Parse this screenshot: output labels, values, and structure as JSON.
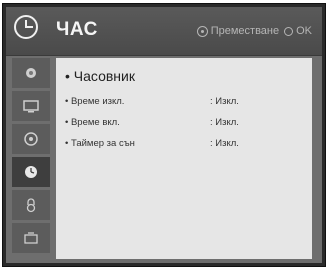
{
  "header": {
    "title": "ЧАС",
    "hint_move": "Преместване",
    "hint_ok": "OK"
  },
  "sidebar": {
    "items": [
      {
        "icon": "picture-icon",
        "active": false
      },
      {
        "icon": "screen-icon",
        "active": false
      },
      {
        "icon": "setup-icon",
        "active": false
      },
      {
        "icon": "clock-icon",
        "active": true
      },
      {
        "icon": "lock-icon",
        "active": false
      },
      {
        "icon": "option-icon",
        "active": false
      }
    ]
  },
  "content": {
    "section_title": "• Часовник",
    "rows": [
      {
        "label": "• Време изкл.",
        "value": ": Изкл."
      },
      {
        "label": "• Време вкл.",
        "value": ": Изкл."
      },
      {
        "label": "• Таймер за сън",
        "value": ": Изкл."
      }
    ]
  },
  "colors": {
    "header_bg": "#4a4a4a",
    "content_bg": "#e6e6e6",
    "active_item_bg": "#3e3e3e"
  }
}
